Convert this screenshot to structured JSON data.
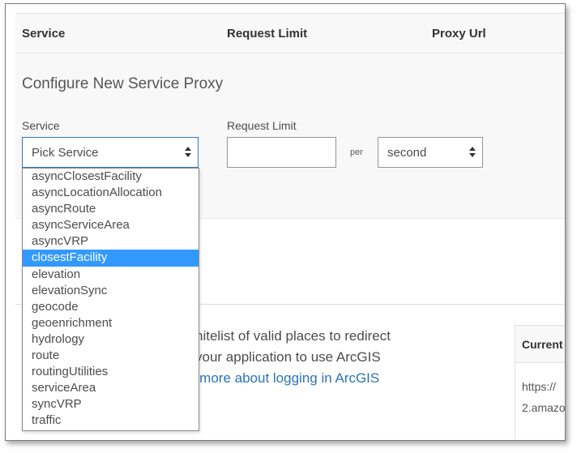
{
  "table": {
    "headers": [
      "Service",
      "Request Limit",
      "Proxy Url"
    ]
  },
  "config": {
    "title": "Configure New Service Proxy",
    "service_label": "Service",
    "limit_label": "Request Limit",
    "service_select_value": "Pick Service",
    "per_label": "per",
    "period_select_value": "second",
    "limit_value": ""
  },
  "dropdown": {
    "selected_index": 5,
    "options": [
      "asyncClosestFacility",
      "asyncLocationAllocation",
      "asyncRoute",
      "asyncServiceArea",
      "asyncVRP",
      "closestFacility",
      "elevation",
      "elevationSync",
      "geocode",
      "geoenrichment",
      "hydrology",
      "route",
      "routingUtilities",
      "serviceArea",
      "syncVRP",
      "traffic"
    ]
  },
  "background": {
    "line1": "hitelist of valid places to redirect",
    "line2": "your application to use ArcGIS",
    "link": "n more about logging in ArcGIS"
  },
  "side_card": {
    "title": "Current",
    "row1": "https://",
    "row2": "2.amazo"
  },
  "colors": {
    "accent": "#3399ff",
    "focus_border": "#2d7bc4",
    "link": "#2a73b8"
  }
}
